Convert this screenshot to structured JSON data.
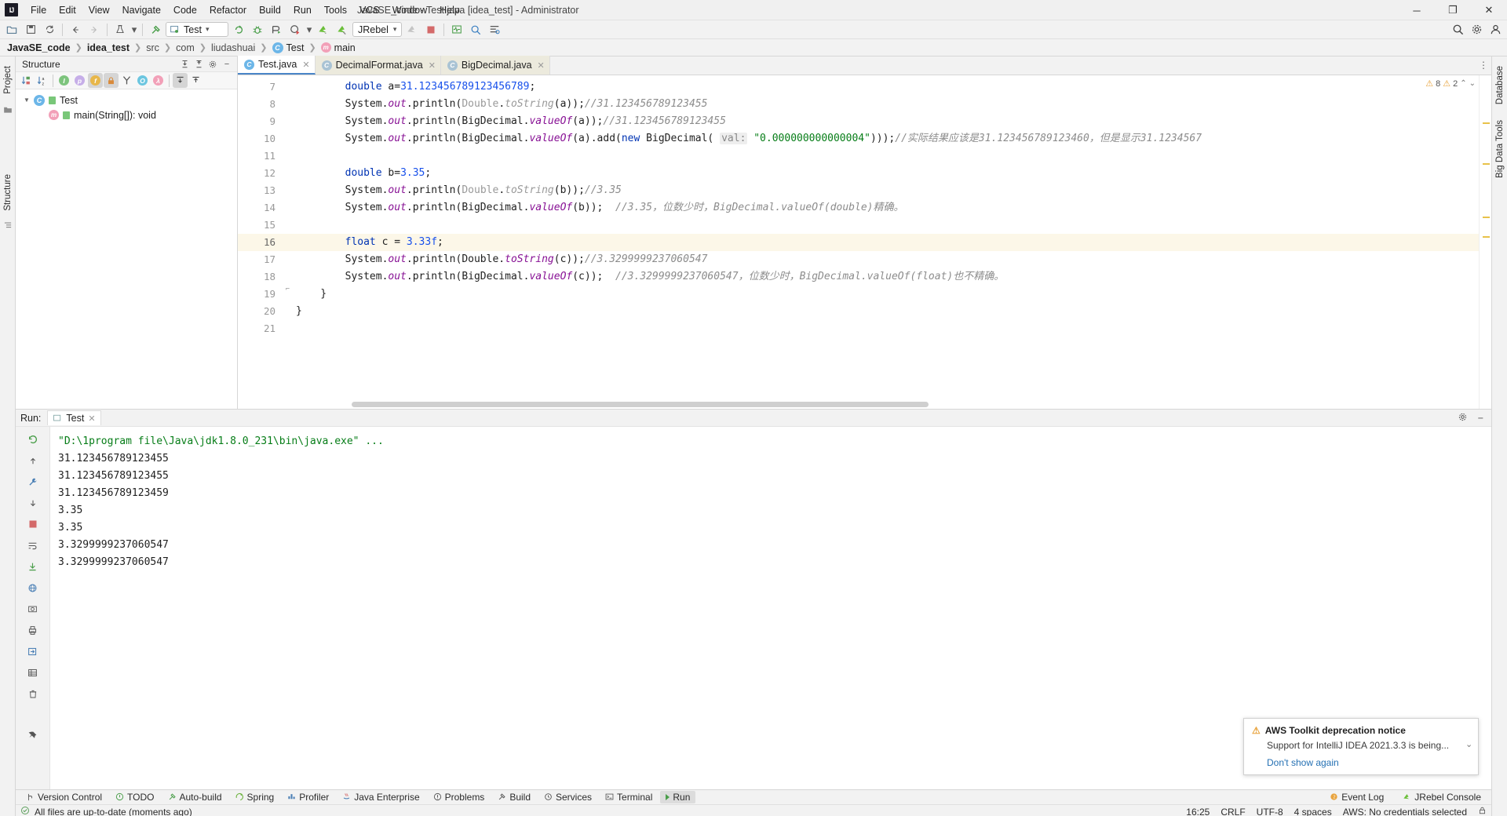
{
  "window": {
    "title": "JavaSE_code - Test.java [idea_test] - Administrator",
    "logo": "IJ",
    "minimize": "─",
    "maximize": "❐",
    "close": "✕"
  },
  "menu": [
    "File",
    "Edit",
    "View",
    "Navigate",
    "Code",
    "Refactor",
    "Build",
    "Run",
    "Tools",
    "VCS",
    "Window",
    "Help"
  ],
  "toolbar": {
    "open_icon": "open-folder-icon",
    "save_icon": "save-icon",
    "sync_icon": "sync-icon",
    "back_icon": "back-arrow-icon",
    "forward_icon": "forward-arrow-icon",
    "run_config_name": "Test",
    "jrebel_label": "JRebel",
    "dropdown_caret": "▾"
  },
  "breadcrumb": [
    {
      "label": "JavaSE_code",
      "bold": true
    },
    {
      "label": "idea_test",
      "bold": true
    },
    {
      "label": "src",
      "bold": false
    },
    {
      "label": "com",
      "bold": false
    },
    {
      "label": "liudashuai",
      "bold": false
    },
    {
      "label": "Test",
      "bold": false,
      "icon": "class-icon"
    },
    {
      "label": "main",
      "bold": false,
      "icon": "method-icon"
    }
  ],
  "left_strip": [
    "Project",
    "Structure"
  ],
  "right_strip": [
    "Database",
    "Big Data Tools"
  ],
  "structure": {
    "title": "Structure",
    "toolbar_icons": [
      "sort-by-visibility-icon",
      "sort-alphabetically-icon",
      "show-inherited-icon",
      "show-properties-icon",
      "show-fields-icon",
      "show-non-public-icon",
      "group-methods-icon",
      "show-anonymous-icon",
      "show-lambdas-icon",
      "expand-all-icon",
      "collapse-all-icon"
    ],
    "nodes": [
      {
        "label": "Test",
        "type": "class",
        "level": 0
      },
      {
        "label": "main(String[]): void",
        "type": "method",
        "level": 1
      }
    ]
  },
  "editor": {
    "tabs": [
      {
        "label": "Test.java",
        "active": true
      },
      {
        "label": "DecimalFormat.java",
        "active": false
      },
      {
        "label": "BigDecimal.java",
        "active": false
      }
    ],
    "inspection": {
      "warnings": "8",
      "weak_warnings": "2"
    },
    "current_line": 16,
    "line_numbers": [
      7,
      8,
      9,
      10,
      11,
      12,
      13,
      14,
      15,
      16,
      17,
      18,
      19,
      20,
      21
    ],
    "lines": [
      {
        "n": 7,
        "segments": [
          {
            "t": "        ",
            "c": "pl"
          },
          {
            "t": "double",
            "c": "kw"
          },
          {
            "t": " a=",
            "c": "pl"
          },
          {
            "t": "31.123456789123456789",
            "c": "num"
          },
          {
            "t": ";",
            "c": "pl"
          }
        ]
      },
      {
        "n": 8,
        "segments": [
          {
            "t": "        System.",
            "c": "pl"
          },
          {
            "t": "out",
            "c": "fld"
          },
          {
            "t": ".println(",
            "c": "pl"
          },
          {
            "t": "Double",
            "c": "gry"
          },
          {
            "t": ".",
            "c": "pl"
          },
          {
            "t": "toString",
            "c": "fldg"
          },
          {
            "t": "(a));",
            "c": "pl"
          },
          {
            "t": "//31.123456789123455",
            "c": "cmt"
          }
        ]
      },
      {
        "n": 9,
        "segments": [
          {
            "t": "        System.",
            "c": "pl"
          },
          {
            "t": "out",
            "c": "fld"
          },
          {
            "t": ".println(BigDecimal.",
            "c": "pl"
          },
          {
            "t": "valueOf",
            "c": "fld"
          },
          {
            "t": "(a));",
            "c": "pl"
          },
          {
            "t": "//31.123456789123455",
            "c": "cmt"
          }
        ]
      },
      {
        "n": 10,
        "segments": [
          {
            "t": "        System.",
            "c": "pl"
          },
          {
            "t": "out",
            "c": "fld"
          },
          {
            "t": ".println(BigDecimal.",
            "c": "pl"
          },
          {
            "t": "valueOf",
            "c": "fld"
          },
          {
            "t": "(a).add(",
            "c": "pl"
          },
          {
            "t": "new",
            "c": "kw"
          },
          {
            "t": " BigDecimal( ",
            "c": "pl"
          },
          {
            "t": "val:",
            "c": "hint"
          },
          {
            "t": " ",
            "c": "pl"
          },
          {
            "t": "\"0.000000000000004\"",
            "c": "str"
          },
          {
            "t": ")));",
            "c": "pl"
          },
          {
            "t": "//实际结果应该是31.123456789123460，但是显示31.1234567",
            "c": "cmt"
          }
        ]
      },
      {
        "n": 11,
        "segments": []
      },
      {
        "n": 12,
        "segments": [
          {
            "t": "        ",
            "c": "pl"
          },
          {
            "t": "double",
            "c": "kw"
          },
          {
            "t": " b=",
            "c": "pl"
          },
          {
            "t": "3.35",
            "c": "num"
          },
          {
            "t": ";",
            "c": "pl"
          }
        ]
      },
      {
        "n": 13,
        "segments": [
          {
            "t": "        System.",
            "c": "pl"
          },
          {
            "t": "out",
            "c": "fld"
          },
          {
            "t": ".println(",
            "c": "pl"
          },
          {
            "t": "Double",
            "c": "gry"
          },
          {
            "t": ".",
            "c": "pl"
          },
          {
            "t": "toString",
            "c": "fldg"
          },
          {
            "t": "(b));",
            "c": "pl"
          },
          {
            "t": "//3.35",
            "c": "cmt"
          }
        ]
      },
      {
        "n": 14,
        "segments": [
          {
            "t": "        System.",
            "c": "pl"
          },
          {
            "t": "out",
            "c": "fld"
          },
          {
            "t": ".println(BigDecimal.",
            "c": "pl"
          },
          {
            "t": "valueOf",
            "c": "fld"
          },
          {
            "t": "(b));  ",
            "c": "pl"
          },
          {
            "t": "//3.35，位数少时，BigDecimal.valueOf(double)精确。",
            "c": "cmt"
          }
        ]
      },
      {
        "n": 15,
        "segments": []
      },
      {
        "n": 16,
        "segments": [
          {
            "t": "        ",
            "c": "pl"
          },
          {
            "t": "float",
            "c": "kw"
          },
          {
            "t": " c = ",
            "c": "pl"
          },
          {
            "t": "3.33f",
            "c": "num"
          },
          {
            "t": ";",
            "c": "pl"
          }
        ]
      },
      {
        "n": 17,
        "segments": [
          {
            "t": "        System.",
            "c": "pl"
          },
          {
            "t": "out",
            "c": "fld"
          },
          {
            "t": ".println(Double.",
            "c": "pl"
          },
          {
            "t": "toString",
            "c": "fld"
          },
          {
            "t": "(c));",
            "c": "pl"
          },
          {
            "t": "//3.3299999237060547",
            "c": "cmt"
          }
        ]
      },
      {
        "n": 18,
        "segments": [
          {
            "t": "        System.",
            "c": "pl"
          },
          {
            "t": "out",
            "c": "fld"
          },
          {
            "t": ".println(BigDecimal.",
            "c": "pl"
          },
          {
            "t": "valueOf",
            "c": "fld"
          },
          {
            "t": "(c));  ",
            "c": "pl"
          },
          {
            "t": "//3.3299999237060547，位数少时，BigDecimal.valueOf(float)也不精确。",
            "c": "cmt"
          }
        ]
      },
      {
        "n": 19,
        "segments": [
          {
            "t": "    }",
            "c": "pl"
          }
        ]
      },
      {
        "n": 20,
        "segments": [
          {
            "t": "}",
            "c": "pl"
          }
        ]
      },
      {
        "n": 21,
        "segments": []
      }
    ]
  },
  "run": {
    "label": "Run:",
    "tab_label": "Test",
    "side_icons": [
      "rerun-icon",
      "scroll-up-icon",
      "wrench-icon",
      "scroll-down-icon",
      "stop-icon",
      "soft-wrap-icon",
      "export-icon",
      "web-icon",
      "camera-icon",
      "print-icon",
      "open-in-icon",
      "grid-icon",
      "trash-icon",
      "pin-icon"
    ],
    "console": [
      {
        "text": "\"D:\\1program file\\Java\\jdk1.8.0_231\\bin\\java.exe\" ...",
        "cmd": true
      },
      {
        "text": "31.123456789123455",
        "cmd": false
      },
      {
        "text": "31.123456789123455",
        "cmd": false
      },
      {
        "text": "31.123456789123459",
        "cmd": false
      },
      {
        "text": "3.35",
        "cmd": false
      },
      {
        "text": "3.35",
        "cmd": false
      },
      {
        "text": "3.3299999237060547",
        "cmd": false
      },
      {
        "text": "3.3299999237060547",
        "cmd": false
      }
    ]
  },
  "notification": {
    "title": "AWS Toolkit deprecation notice",
    "body": "Support for IntelliJ IDEA 2021.3.3 is being...",
    "link": "Don't show again",
    "warn_icon": "warning-icon",
    "collapse_icon": "chevron-down-icon"
  },
  "bottom_toolbar": {
    "items": [
      {
        "label": "Version Control",
        "icon": "branch-icon",
        "active": false
      },
      {
        "label": "TODO",
        "icon": "todo-icon",
        "active": false
      },
      {
        "label": "Auto-build",
        "icon": "autobuild-icon",
        "active": false
      },
      {
        "label": "Spring",
        "icon": "spring-icon",
        "active": false
      },
      {
        "label": "Profiler",
        "icon": "profiler-icon",
        "active": false
      },
      {
        "label": "Java Enterprise",
        "icon": "java-enterprise-icon",
        "active": false
      },
      {
        "label": "Problems",
        "icon": "problems-icon",
        "active": false
      },
      {
        "label": "Build",
        "icon": "build-icon",
        "active": false
      },
      {
        "label": "Services",
        "icon": "services-icon",
        "active": false
      },
      {
        "label": "Terminal",
        "icon": "terminal-icon",
        "active": false
      },
      {
        "label": "Run",
        "icon": "run-icon",
        "active": true
      }
    ],
    "right": [
      {
        "label": "Event Log",
        "icon": "event-log-icon"
      },
      {
        "label": "JRebel Console",
        "icon": "jrebel-icon"
      }
    ]
  },
  "statusbar": {
    "message": "All files are up-to-date (moments ago)",
    "time": "16:25",
    "line_sep": "CRLF",
    "encoding": "UTF-8",
    "indent": "4 spaces",
    "aws": "AWS: No credentials selected",
    "lock_icon": "lock-icon"
  }
}
